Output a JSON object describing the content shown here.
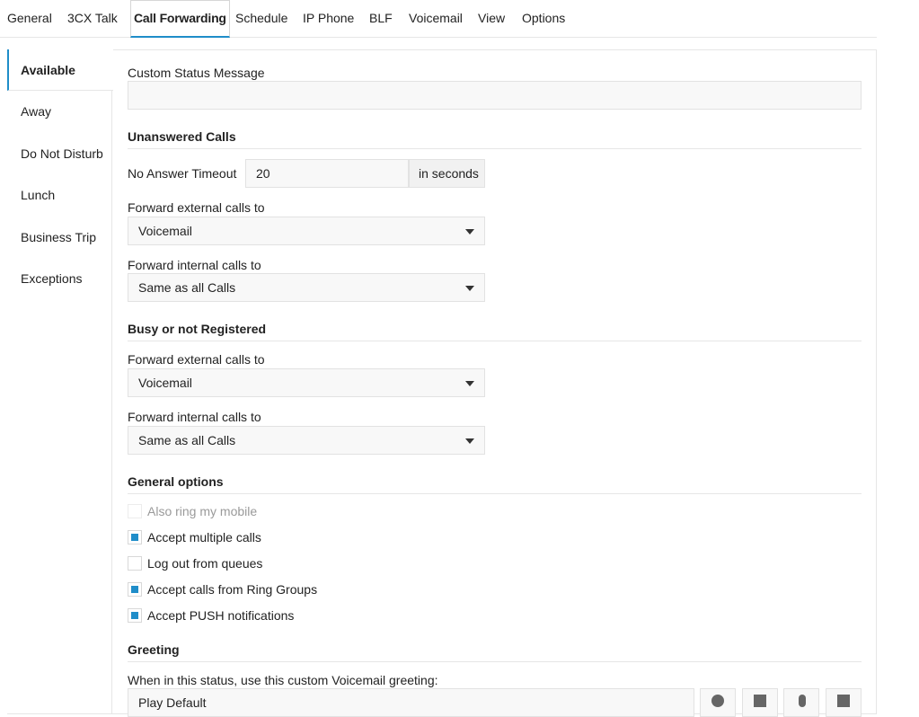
{
  "tabs": [
    {
      "label": "General"
    },
    {
      "label": "3CX Talk"
    },
    {
      "label": "Call Forwarding"
    },
    {
      "label": "Schedule"
    },
    {
      "label": "IP Phone"
    },
    {
      "label": "BLF"
    },
    {
      "label": "Voicemail"
    },
    {
      "label": "View"
    },
    {
      "label": "Options"
    }
  ],
  "active_tab": "Call Forwarding",
  "accent_color": "#1f8dc9",
  "sidebar": {
    "items": [
      {
        "label": "Available"
      },
      {
        "label": "Away"
      },
      {
        "label": "Do Not Disturb"
      },
      {
        "label": "Lunch"
      },
      {
        "label": "Business Trip"
      },
      {
        "label": "Exceptions"
      }
    ],
    "active": "Available"
  },
  "custom_status": {
    "label": "Custom Status Message",
    "value": ""
  },
  "unanswered": {
    "title": "Unanswered Calls",
    "timeout_label": "No Answer Timeout",
    "timeout_value": "20",
    "timeout_unit": "in seconds",
    "external_label": "Forward external calls to",
    "external_value": "Voicemail",
    "internal_label": "Forward internal calls to",
    "internal_value": "Same as all Calls"
  },
  "busy": {
    "title": "Busy or not Registered",
    "external_label": "Forward external calls to",
    "external_value": "Voicemail",
    "internal_label": "Forward internal calls to",
    "internal_value": "Same as all Calls"
  },
  "general_options": {
    "title": "General options",
    "options": [
      {
        "label": "Also ring my mobile",
        "checked": false,
        "disabled": true
      },
      {
        "label": "Accept multiple calls",
        "checked": true,
        "disabled": false
      },
      {
        "label": "Log out from queues",
        "checked": false,
        "disabled": false
      },
      {
        "label": "Accept calls from Ring Groups",
        "checked": true,
        "disabled": false
      },
      {
        "label": "Accept PUSH notifications",
        "checked": true,
        "disabled": false
      }
    ]
  },
  "greeting": {
    "title": "Greeting",
    "label": "When in this status, use this custom Voicemail greeting:",
    "value": "Play Default"
  }
}
